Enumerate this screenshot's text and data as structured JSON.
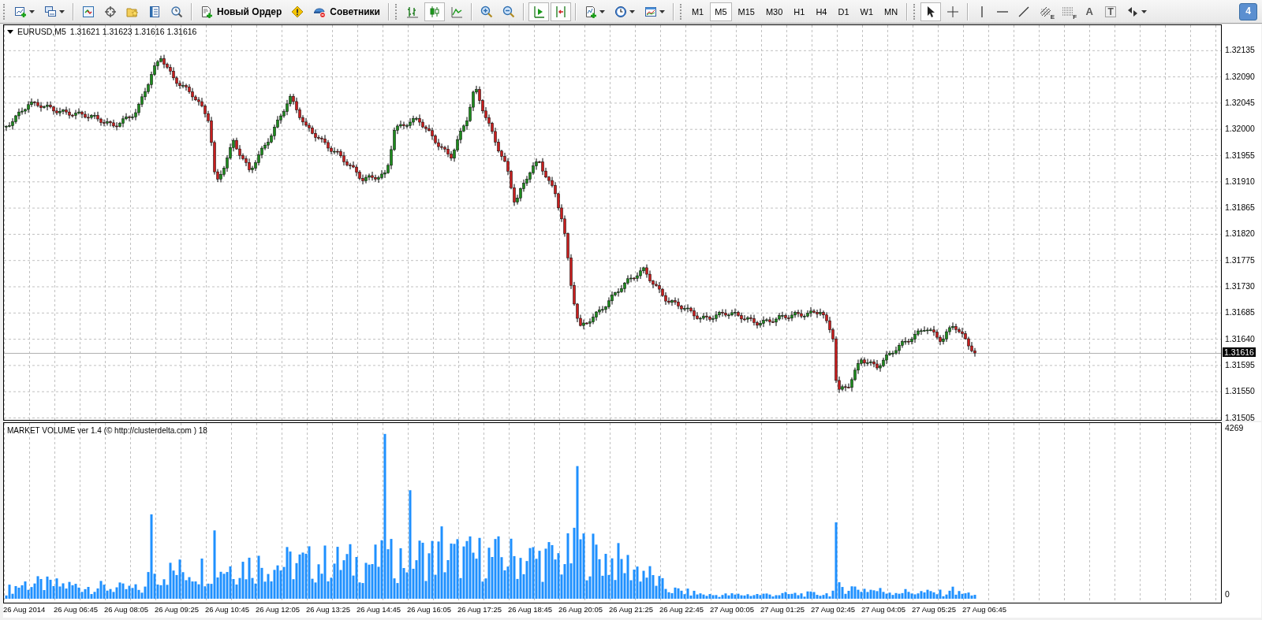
{
  "toolbar": {
    "new_order": "Новый Ордер",
    "experts": "Советники",
    "chart_style": [
      {
        "selected": false
      },
      {
        "selected": true
      },
      {
        "selected": false
      }
    ],
    "auto_scroll": true,
    "chart_shift": true,
    "timeframes": [
      {
        "label": "M1",
        "selected": false
      },
      {
        "label": "M5",
        "selected": true
      },
      {
        "label": "M15",
        "selected": false
      },
      {
        "label": "M30",
        "selected": false
      },
      {
        "label": "H1",
        "selected": false
      },
      {
        "label": "H4",
        "selected": false
      },
      {
        "label": "D1",
        "selected": false
      },
      {
        "label": "W1",
        "selected": false
      },
      {
        "label": "MN",
        "selected": false
      }
    ],
    "tools": [
      {
        "kind": "cursor",
        "selected": true
      },
      {
        "kind": "crosshair",
        "selected": false
      },
      {
        "kind": "vline",
        "selected": false
      },
      {
        "kind": "hline",
        "selected": false
      },
      {
        "kind": "trendline",
        "selected": false
      },
      {
        "kind": "fibo_channel",
        "glyph": "E",
        "selected": false
      },
      {
        "kind": "fibo",
        "glyph": "F",
        "selected": false
      },
      {
        "kind": "text",
        "glyph": "A",
        "selected": false
      },
      {
        "kind": "label",
        "glyph": "T",
        "selected": false
      },
      {
        "kind": "arrows",
        "selected": false
      }
    ],
    "notifications": "4"
  },
  "chart": {
    "symbol": "EURUSD,M5",
    "quote": "1.31621 1.31623 1.31616 1.31616",
    "price_ticks": [
      "1.32135",
      "1.32090",
      "1.32045",
      "1.32000",
      "1.31955",
      "1.31910",
      "1.31865",
      "1.31820",
      "1.31775",
      "1.31730",
      "1.31685",
      "1.31640",
      "1.31595",
      "1.31550",
      "1.31505"
    ],
    "current_price": "1.31616"
  },
  "indicator": {
    "label": "MARKET VOLUME ver 1.4 (© http://clusterdelta.com ) 18",
    "scale_max": "4269",
    "scale_min": "0"
  },
  "time_labels": [
    "26 Aug 2014",
    "26 Aug 06:45",
    "26 Aug 08:05",
    "26 Aug 09:25",
    "26 Aug 10:45",
    "26 Aug 12:05",
    "26 Aug 13:25",
    "26 Aug 14:45",
    "26 Aug 16:05",
    "26 Aug 17:25",
    "26 Aug 18:45",
    "26 Aug 20:05",
    "26 Aug 21:25",
    "26 Aug 22:45",
    "27 Aug 00:05",
    "27 Aug 01:25",
    "27 Aug 02:45",
    "27 Aug 04:05",
    "27 Aug 05:25",
    "27 Aug 06:45"
  ]
}
